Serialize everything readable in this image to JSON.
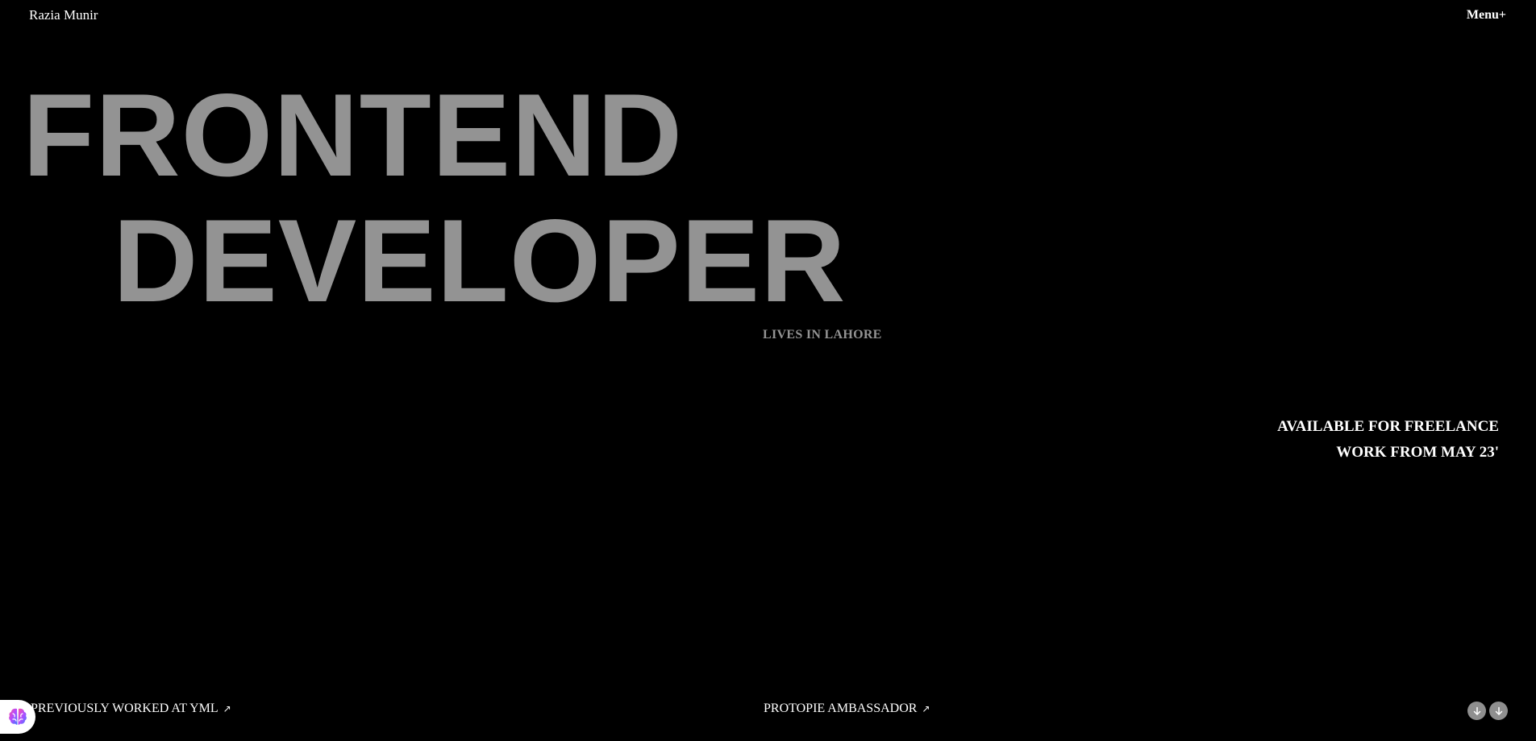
{
  "header": {
    "brand": "Razia Munir",
    "menu_label": "Menu+"
  },
  "hero": {
    "line1": "FRONTEND",
    "line2": "DEVELOPER",
    "tagline": "LIVES IN LAHORE"
  },
  "availability": {
    "line1": "AVAILABLE FOR FREELANCE",
    "line2": "WORK FROM MAY 23'"
  },
  "footer": {
    "previous_work": "PREVIOUSLY WORKED AT YML",
    "ambassador": "PROTOPIE AMBASSADOR",
    "link_arrow": "↗",
    "scroll_icons": [
      "arrow-down-icon",
      "arrow-down-icon"
    ]
  },
  "colors": {
    "background": "#000000",
    "hero_text": "#939393",
    "text": "#ffffff",
    "button": "#8f8f8f"
  }
}
